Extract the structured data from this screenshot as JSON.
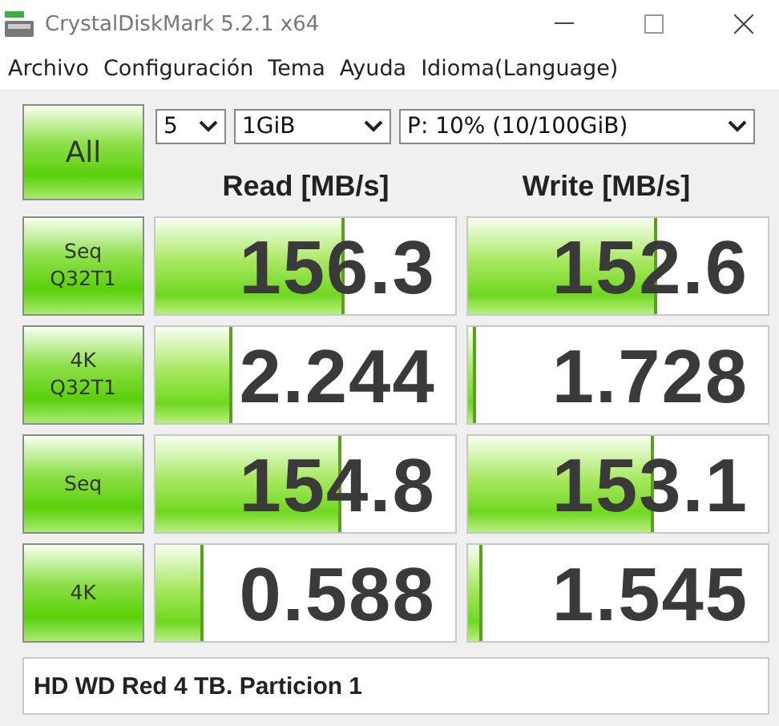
{
  "window": {
    "title": "CrystalDiskMark 5.2.1 x64"
  },
  "menu": [
    "Archivo",
    "Configuración",
    "Tema",
    "Ayuda",
    "Idioma(Language)"
  ],
  "all_button": "All",
  "selects": [
    {
      "value": "5"
    },
    {
      "value": "1GiB"
    },
    {
      "value": "P: 10% (10/100GiB)"
    }
  ],
  "headers": [
    "Read [MB/s]",
    "Write [MB/s]"
  ],
  "rows": [
    {
      "label": [
        "Seq",
        "Q32T1"
      ],
      "read": {
        "value": "156.3",
        "level": 0.63
      },
      "write": {
        "value": "152.6",
        "level": 0.63
      }
    },
    {
      "label": [
        "4K",
        "Q32T1"
      ],
      "read": {
        "value": "2.244",
        "level": 0.26
      },
      "write": {
        "value": "1.728",
        "level": 0.03
      }
    },
    {
      "label": [
        "Seq"
      ],
      "read": {
        "value": "154.8",
        "level": 0.62
      },
      "write": {
        "value": "153.1",
        "level": 0.62
      }
    },
    {
      "label": [
        "4K"
      ],
      "read": {
        "value": "0.588",
        "level": 0.16
      },
      "write": {
        "value": "1.545",
        "level": 0.05
      }
    }
  ],
  "comment": "HD WD Red 4 TB. Particion 1"
}
